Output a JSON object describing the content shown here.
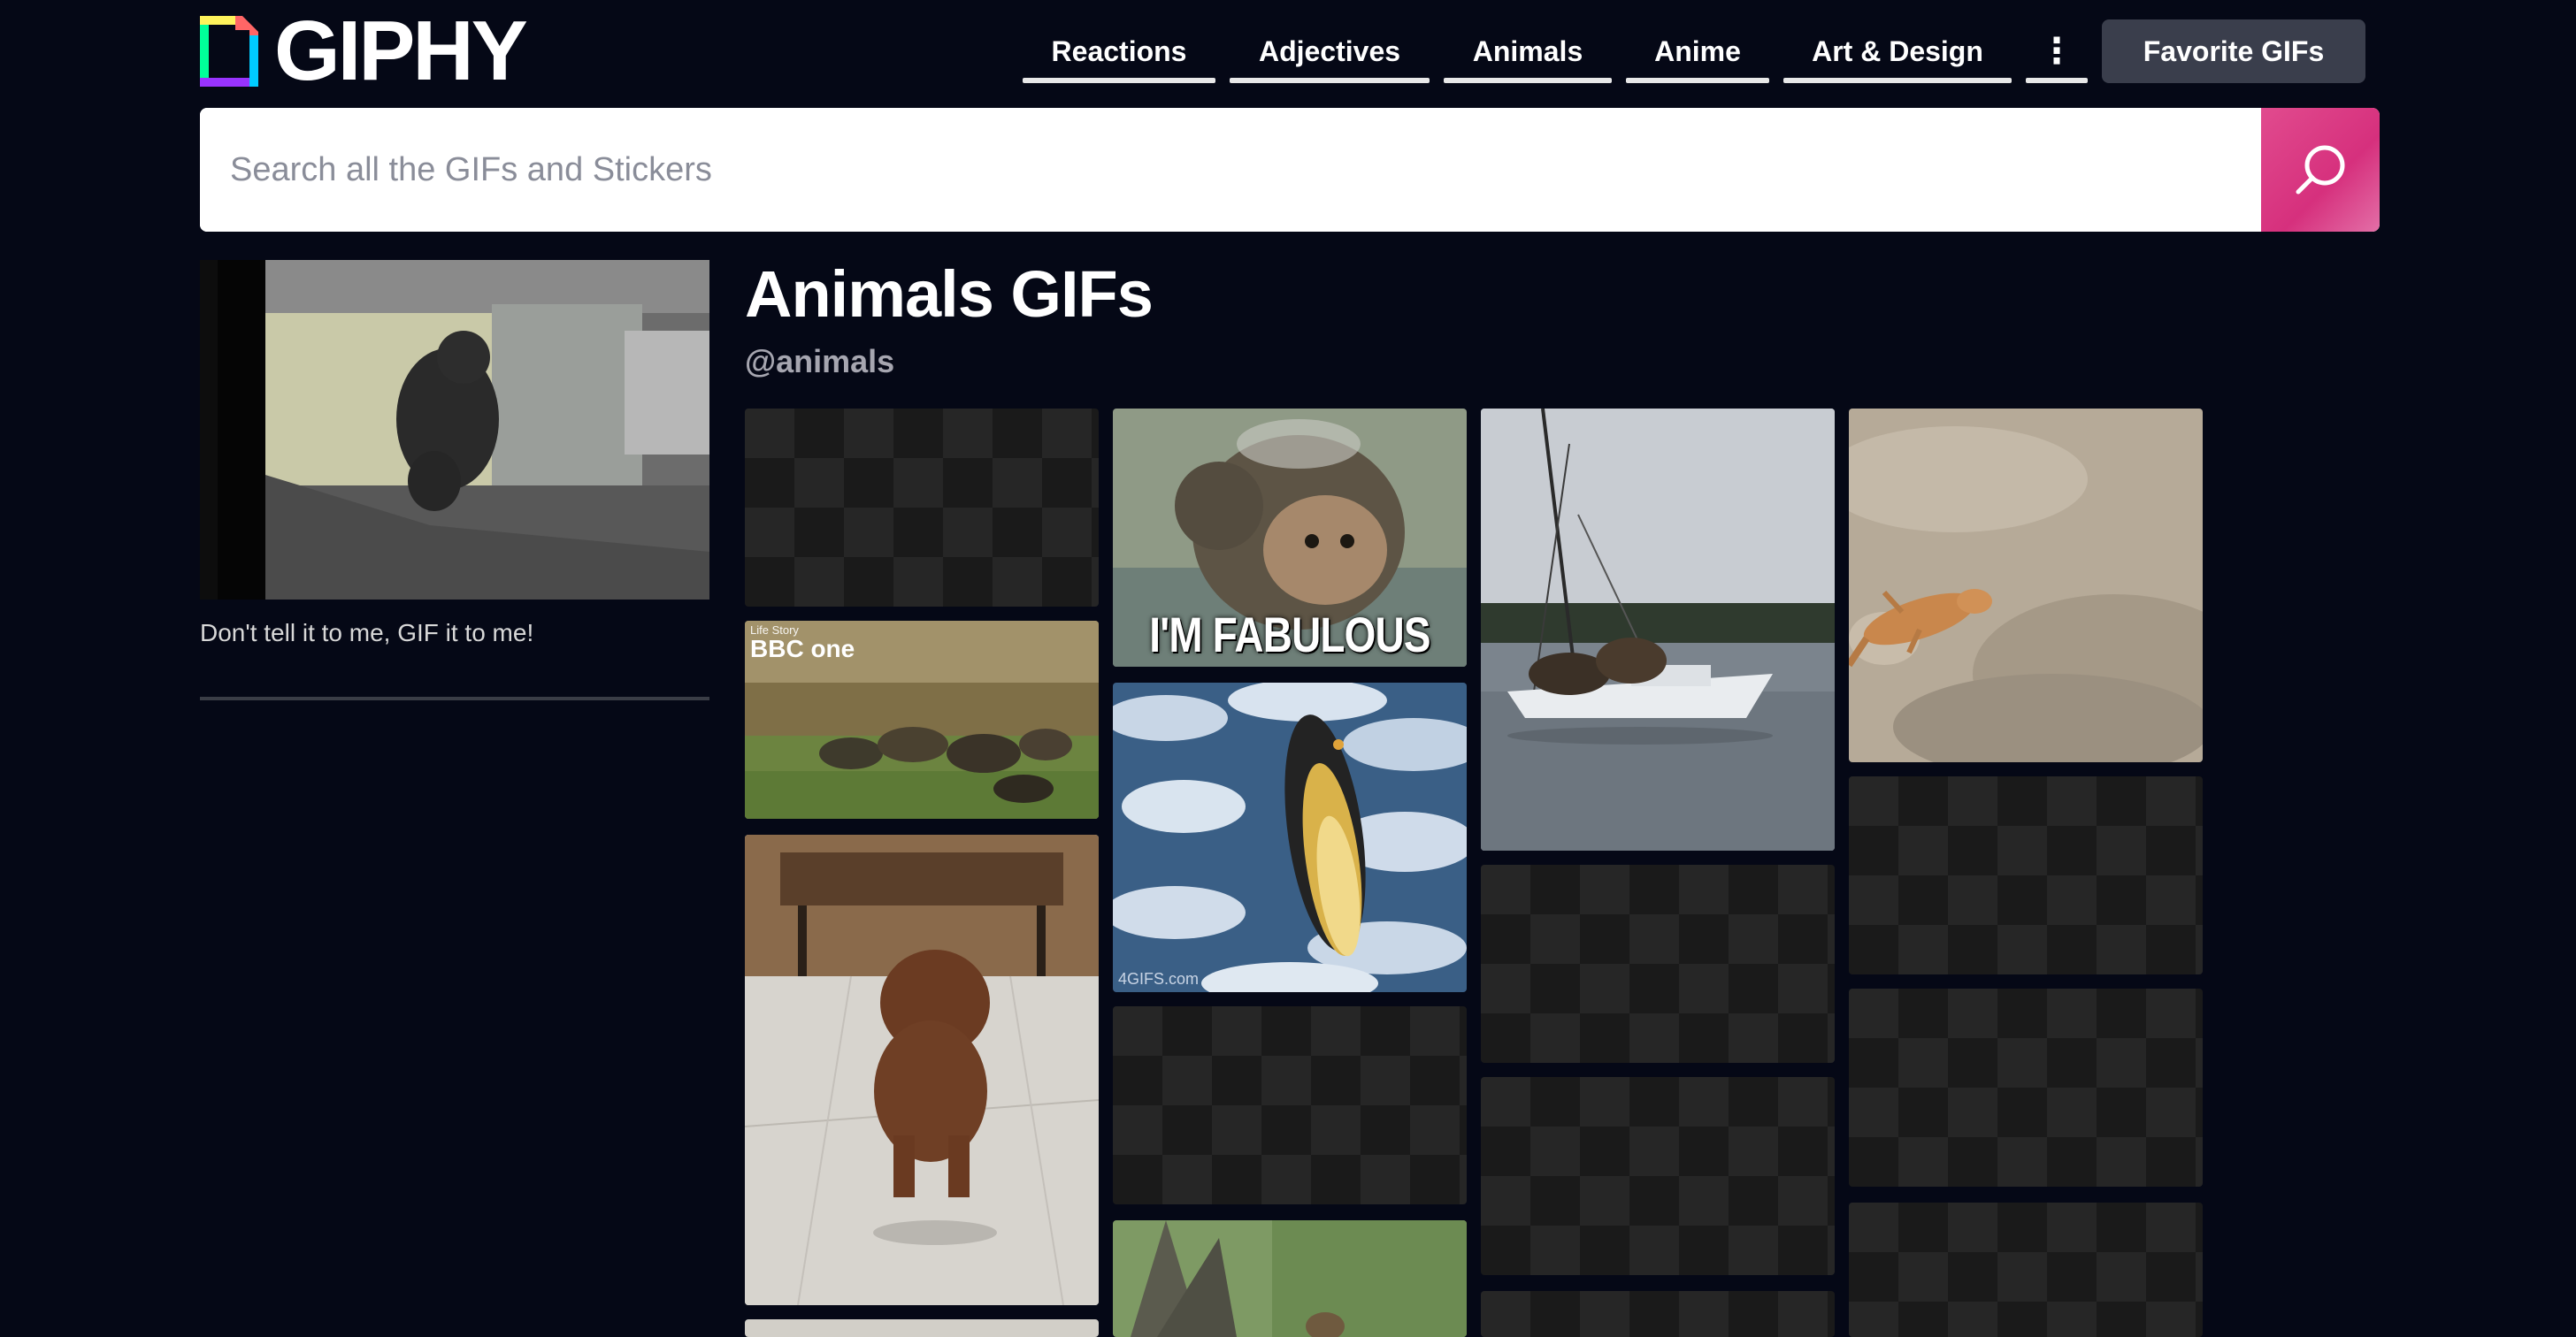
{
  "brand": {
    "name": "GIPHY"
  },
  "nav": {
    "items": [
      {
        "label": "Reactions"
      },
      {
        "label": "Adjectives"
      },
      {
        "label": "Animals"
      },
      {
        "label": "Anime"
      },
      {
        "label": "Art & Design"
      }
    ],
    "more_icon": "vertical-ellipsis-icon",
    "more_glyph": "⋮",
    "favorite_label": "Favorite GIFs"
  },
  "search": {
    "placeholder": "Search all the GIFs and Stickers",
    "value": "",
    "button_icon": "search-icon"
  },
  "channel": {
    "title": "Animals GIFs",
    "handle": "@animals",
    "tagline": "Don't tell it to me, GIF it to me!"
  },
  "gifs": {
    "fabulous_caption": "I'M FABULOUS",
    "bbc_line": "Life Story",
    "bbc_brand": "BBC one",
    "penguin_watermark": "4GIFS.com"
  },
  "colors": {
    "background": "#050816",
    "search_button": "#d6307d",
    "favorite_button": "#3a3e4c",
    "nav_underline": "#e8e8e8"
  }
}
